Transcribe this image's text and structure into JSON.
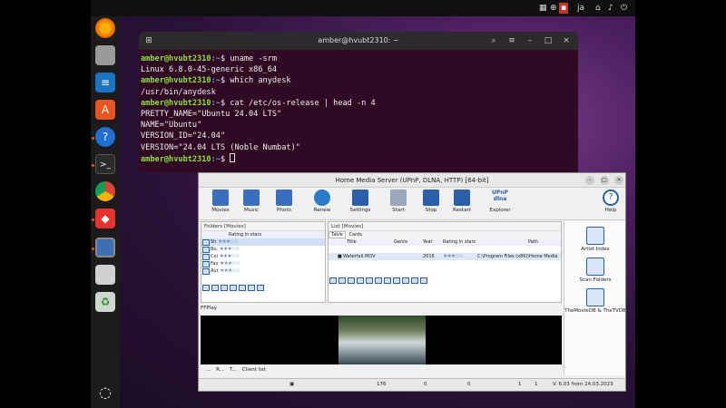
{
  "topbar": {
    "lang": "ja",
    "power": "⏻"
  },
  "dock": {
    "items": [
      "firefox-icon",
      "files-icon",
      "writer-icon",
      "appcenter-icon",
      "help-icon",
      "terminal-icon",
      "chrome-icon",
      "anydesk-icon",
      "hms-icon",
      "disk-icon",
      "trash-icon",
      "apps-grid-icon"
    ]
  },
  "terminal": {
    "title": "amber@hvubt2310: ~",
    "lines": [
      {
        "user": "amber@hvubt2310",
        "path": ":~",
        "cmd": "$ uname -srm"
      },
      {
        "out": "Linux 6.8.0-45-generic x86_64"
      },
      {
        "user": "amber@hvubt2310",
        "path": ":~",
        "cmd": "$ which anydesk"
      },
      {
        "out": "/usr/bin/anydesk"
      },
      {
        "user": "amber@hvubt2310",
        "path": ":~",
        "cmd": "$ cat /etc/os-release | head -n 4"
      },
      {
        "out": "PRETTY_NAME=\"Ubuntu 24.04 LTS\""
      },
      {
        "out": "NAME=\"Ubuntu\""
      },
      {
        "out": "VERSION_ID=\"24.04\""
      },
      {
        "out": "VERSION=\"24.04 LTS (Noble Numbat)\""
      },
      {
        "user": "amber@hvubt2310",
        "path": ":~",
        "cmd": "$ "
      }
    ]
  },
  "hms": {
    "title": "Home Media Server (UPnP, DLNA, HTTP) [64-bit]",
    "toolbar": [
      {
        "label": "Movies",
        "color": "#3a6fc0"
      },
      {
        "label": "Music",
        "color": "#3a6fc0"
      },
      {
        "label": "Photo",
        "color": "#3a6fc0"
      },
      {
        "label": "Renew",
        "color": "#2a7acc"
      },
      {
        "label": "Settings",
        "color": "#2a5faa"
      },
      {
        "label": "Start",
        "color": "#9aa8bb"
      },
      {
        "label": "Stop",
        "color": "#2a5faa"
      },
      {
        "label": "Restart",
        "color": "#2a5faa"
      },
      {
        "label": "Explorer",
        "color": "#2a5faa"
      },
      {
        "label": "Help",
        "color": "#2a5faa"
      }
    ],
    "folders": {
      "header": "Folders [Movies]",
      "col_rating": "Rating in stars",
      "rows": [
        {
          "name": "Sh",
          "stars": "★★★☆☆",
          "selected": true
        },
        {
          "name": "Bo.",
          "stars": "★★★☆☆"
        },
        {
          "name": "Col",
          "stars": "★★★☆☆"
        },
        {
          "name": "Fav",
          "stars": "★★★☆☆"
        },
        {
          "name": "Aut",
          "stars": "★★★☆☆"
        }
      ]
    },
    "list": {
      "header": "List [Movies]",
      "tabs": [
        "Table",
        "Cards"
      ],
      "columns": [
        "Title",
        "Genre",
        "Year",
        "Rating in stars",
        "Path"
      ],
      "rows": [
        {
          "title": "Waterfall.MOV",
          "genre": "",
          "year": "2016",
          "stars": "★★★☆☆",
          "path": "C:\\Program Files (x86)\\Home Media"
        }
      ]
    },
    "player": {
      "label": "FFPlay"
    },
    "client": {
      "tabs": [
        "...",
        "R...",
        "T...",
        "Client list"
      ]
    },
    "right": [
      {
        "label": "Artist Index"
      },
      {
        "label": "Scan Folders"
      },
      {
        "label": "TheMovieDB & TheTVDB"
      }
    ],
    "status": {
      "c1": "176",
      "c2": "0",
      "c3": "0",
      "c4": "1",
      "c5": "1",
      "version": "V. 6.03 from 24.03.2023"
    }
  }
}
